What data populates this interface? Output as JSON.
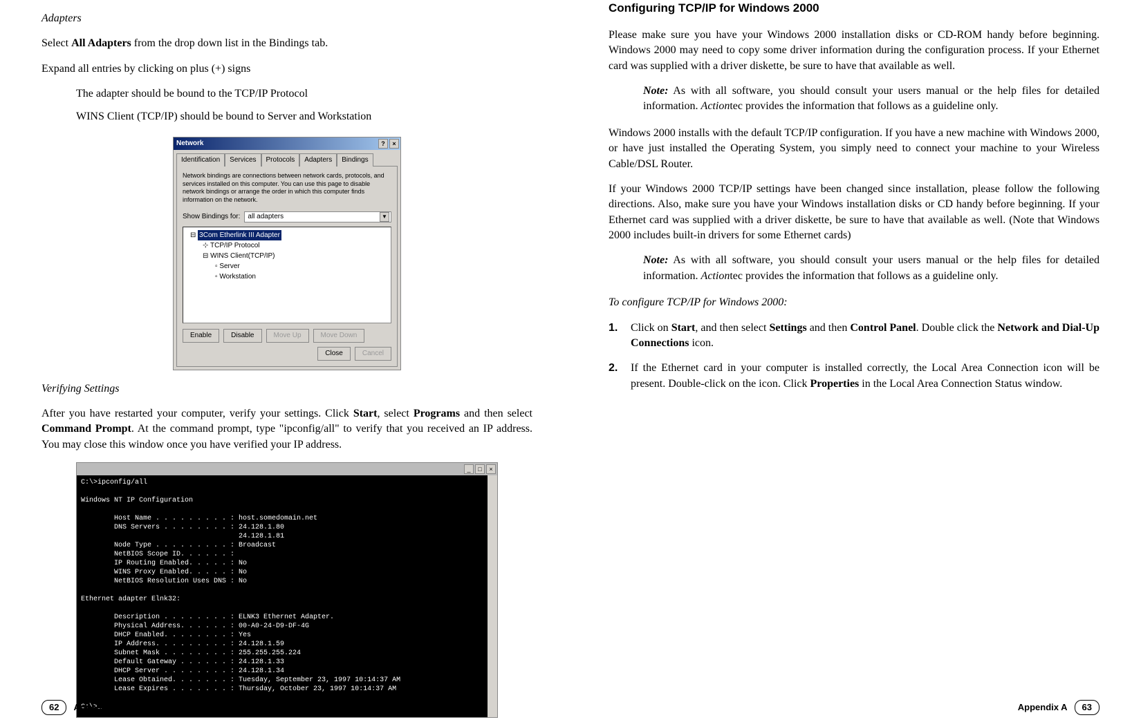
{
  "left": {
    "heading_adapters": "Adapters",
    "p1_a": "Select ",
    "p1_b": "All Adapters",
    "p1_c": " from the drop down list in the Bindings tab.",
    "p2": "Expand all entries by clicking on plus (+) signs",
    "p3": "The adapter should be bound to the TCP/IP Protocol",
    "p4": "WINS Client (TCP/IP) should be bound to Server and Workstation",
    "dialog": {
      "title": "Network",
      "help": "?",
      "close": "×",
      "tabs": [
        "Identification",
        "Services",
        "Protocols",
        "Adapters",
        "Bindings"
      ],
      "desc": "Network bindings are connections between network cards, protocols, and services installed on this computer. You can use this page to disable network bindings or arrange the order in which this computer finds information on the network.",
      "show_label": "Show Bindings for:",
      "show_value": "all adapters",
      "tree_root": "3Com Etherlink III Adapter",
      "tree_tcpip": "TCP/IP Protocol",
      "tree_wins": "WINS Client(TCP/IP)",
      "tree_server": "Server",
      "tree_workstation": "Workstation",
      "enable": "Enable",
      "disable": "Disable",
      "moveup": "Move Up",
      "movedn": "Move Down",
      "closebtn": "Close",
      "cancel": "Cancel"
    },
    "heading_verify": "Verifying Settings",
    "verify_a": "After you have restarted your computer, verify your settings. Click ",
    "verify_b": "Start",
    "verify_c": ", select ",
    "verify_d": "Programs",
    "verify_e": " and then select ",
    "verify_f": "Command Prompt",
    "verify_g": ". At the command prompt, type \"ipconfig/all\" to verify that you received an IP address. You may close this window once you have verified your IP address.",
    "term_title": " ",
    "terminal": "C:\\>ipconfig/all\n\nWindows NT IP Configuration\n\n        Host Name . . . . . . . . . : host.somedomain.net\n        DNS Servers . . . . . . . . : 24.128.1.80\n                                      24.128.1.81\n        Node Type . . . . . . . . . : Broadcast\n        NetBIOS Scope ID. . . . . . :\n        IP Routing Enabled. . . . . : No\n        WINS Proxy Enabled. . . . . : No\n        NetBIOS Resolution Uses DNS : No\n\nEthernet adapter Elnk32:\n\n        Description . . . . . . . . : ELNK3 Ethernet Adapter.\n        Physical Address. . . . . . : 00-A0-24-D9-DF-4G\n        DHCP Enabled. . . . . . . . : Yes\n        IP Address. . . . . . . . . : 24.128.1.59\n        Subnet Mask . . . . . . . . : 255.255.255.224\n        Default Gateway . . . . . . : 24.128.1.33\n        DHCP Server . . . . . . . . : 24.128.1.34\n        Lease Obtained. . . . . . . : Tuesday, September 23, 1997 10:14:37 AM\n        Lease Expires . . . . . . . : Thursday, October 23, 1997 10:14:37 AM\n\nC:\\>_",
    "footer_num": "62",
    "footer_label": "Appendix A"
  },
  "right": {
    "heading": "Configuring TCP/IP for Windows 2000",
    "p1": "Please make sure you have your Windows 2000 installation disks or CD-ROM handy before beginning. Windows 2000 may need to copy some driver information during the configuration process. If your Ethernet card was supplied with a driver diskette, be sure to have that available as well.",
    "note_label": "Note:",
    "note1_a": " As with all software, you should consult your users manual or the help files for detailed information. ",
    "note1_b": "Action",
    "note1_c": "tec provides the information that follows as a guideline only.",
    "p2": "Windows 2000 installs with the default TCP/IP configuration. If you have a new machine with Windows 2000, or have just installed the Operating System, you simply need to connect your machine to your Wireless Cable/DSL Router.",
    "p3": "If your Windows 2000 TCP/IP settings have been changed since installation, please follow the following directions. Also, make sure you have your Windows installation disks or CD handy before beginning. If your Ethernet card was supplied with a driver diskette, be sure to have that available as well. (Note that Windows 2000 includes built-in drivers for some Ethernet cards)",
    "toconfig": "To configure TCP/IP for Windows 2000:",
    "step1_num": "1.",
    "step1_a": "Click on ",
    "step1_b": "Start",
    "step1_c": ", and then select ",
    "step1_d": "Settings",
    "step1_e": " and then ",
    "step1_f": "Control Panel",
    "step1_g": ". Double click the ",
    "step1_h": "Network and Dial-Up Connections",
    "step1_i": " icon.",
    "step2_num": "2.",
    "step2_a": "If the Ethernet card in your computer is installed correctly, the Local Area Connection icon will be present. Double-click on the icon. Click ",
    "step2_b": "Properties",
    "step2_c": " in the Local Area Connection Status window.",
    "footer_label": "Appendix A",
    "footer_num": "63"
  }
}
